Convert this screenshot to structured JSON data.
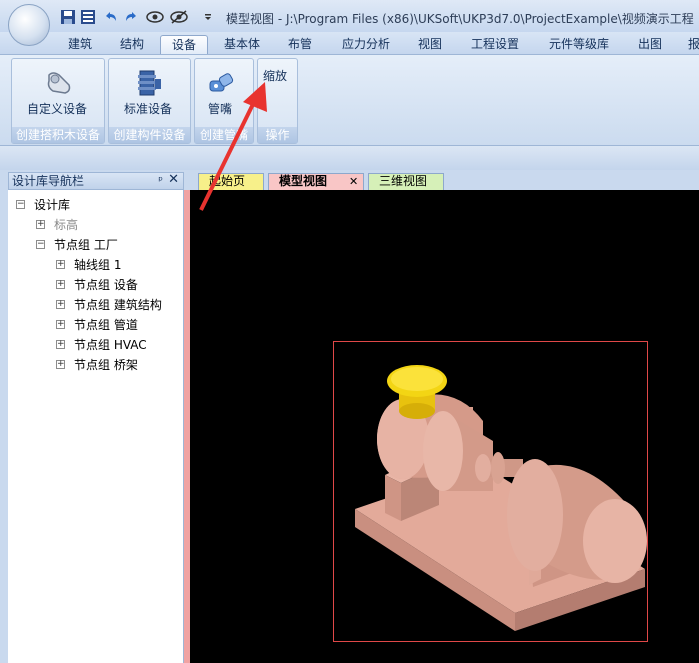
{
  "window": {
    "title": "模型视图 - J:\\Program Files (x86)\\UKSoft\\UKP3d7.0\\ProjectExample\\视频演示工程"
  },
  "quick_access": [
    "save-icon",
    "save-as-icon",
    "undo-icon",
    "redo-icon",
    "show-icon",
    "hide-icon",
    "dropdown-arrow-icon"
  ],
  "menu_tabs": [
    "建筑",
    "结构",
    "设备",
    "基本体",
    "布管",
    "应力分析",
    "视图",
    "工程设置",
    "元件等级库",
    "出图",
    "报"
  ],
  "active_tab": "设备",
  "ribbon": {
    "groups": [
      {
        "caption": "创建搭积木设备",
        "buttons": [
          {
            "label": "自定义设备",
            "icon": "custom-equipment-icon"
          }
        ]
      },
      {
        "caption": "创建构件设备",
        "buttons": [
          {
            "label": "标准设备",
            "icon": "standard-equipment-icon"
          }
        ]
      },
      {
        "caption": "创建管嘴",
        "buttons": [
          {
            "label": "管嘴",
            "icon": "nozzle-icon"
          }
        ]
      },
      {
        "caption": "操作",
        "buttons": [
          {
            "label": "缩放",
            "icon": ""
          }
        ]
      }
    ]
  },
  "navigator": {
    "title": "设计库导航栏",
    "pin": "ᵖ",
    "close": "✕",
    "tree": [
      {
        "label": "设计库",
        "expander": "−"
      },
      {
        "label": "标高",
        "expander": "+"
      },
      {
        "label": "节点组 工厂",
        "expander": "−"
      },
      {
        "label": "轴线组 1",
        "expander": "+"
      },
      {
        "label": "节点组 设备",
        "expander": "+"
      },
      {
        "label": "节点组 建筑结构",
        "expander": "+"
      },
      {
        "label": "节点组 管道",
        "expander": "+"
      },
      {
        "label": "节点组 HVAC",
        "expander": "+"
      },
      {
        "label": "节点组 桥架",
        "expander": "+"
      }
    ]
  },
  "doc_tabs": [
    {
      "label": "起始页",
      "color": "#f7f08a"
    },
    {
      "label": "模型视图",
      "color": "#f9c6c6",
      "close": "✕",
      "active": true
    },
    {
      "label": "三维视图",
      "color": "#d6f0b8"
    }
  ],
  "colors": {
    "arrow": "#e8332f",
    "model_body": "#e3aa9a",
    "model_cap": "#f3d514",
    "viewport_bg": "#000000"
  }
}
